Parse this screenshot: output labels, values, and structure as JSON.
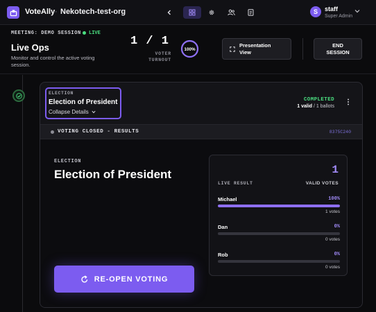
{
  "app": {
    "name": "VoteAlly",
    "separator": "·",
    "org": "Nekotech-test-org"
  },
  "nav": {
    "icons": [
      "chevron-left-icon",
      "dashboard-icon",
      "gear-icon",
      "users-icon",
      "document-icon"
    ],
    "active": "dashboard-icon"
  },
  "user": {
    "initial": "S",
    "name": "staff",
    "role": "Super Admin"
  },
  "header": {
    "meeting_label": "MEETING: DEMO SESSION",
    "live_label": "LIVE",
    "title": "Live Ops",
    "subtitle": "Monitor and control the active voting session.",
    "turnout_count": "1 / 1",
    "turnout_label_line1": "VOTER",
    "turnout_label_line2": "TURNOUT",
    "turnout_percent_text": "100%",
    "turnout_fraction": 1.0,
    "presentation_label_line1": "Presentation",
    "presentation_label_line2": "View",
    "end_label_line1": "END",
    "end_label_line2": "SESSION"
  },
  "election": {
    "label": "ELECTION",
    "title": "Election of President",
    "collapse_label": "Collapse Details",
    "status": "COMPLETED",
    "valid_count": "1 valid",
    "ballot_count": " / 1 ballots"
  },
  "voting_bar": {
    "label": "VOTING CLOSED - RESULTS",
    "code": "8375C240"
  },
  "results": {
    "label": "ELECTION",
    "title": "Election of President",
    "reopen_label": "RE-OPEN VOTING",
    "live_result_label": "LIVE RESULT",
    "valid_votes_count": "1",
    "valid_votes_label": "VALID VOTES",
    "candidates": [
      {
        "name": "Michael",
        "percent": "100%",
        "votes": "1 votes",
        "fraction": 1.0
      },
      {
        "name": "Dan",
        "percent": "0%",
        "votes": "0 votes",
        "fraction": 0.0
      },
      {
        "name": "Rob",
        "percent": "0%",
        "votes": "0 votes",
        "fraction": 0.0
      }
    ]
  },
  "colors": {
    "accent": "#7c5cf0",
    "live": "#4ade80",
    "background": "#0b0b0d"
  }
}
